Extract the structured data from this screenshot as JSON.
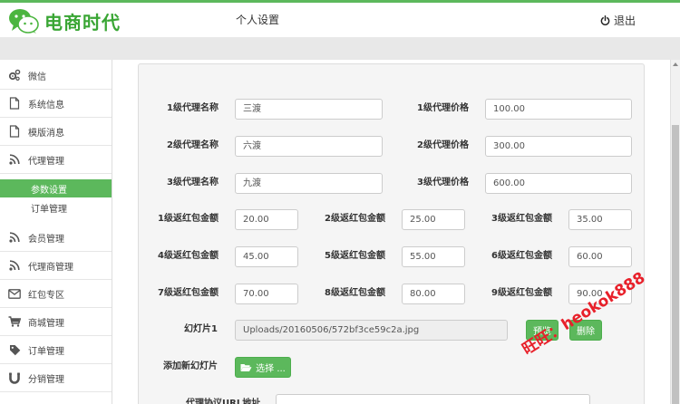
{
  "header": {
    "brand": "电商时代",
    "page_title": "个人设置",
    "logout_label": "退出",
    "accent_color": "#5cb85c"
  },
  "sidebar": {
    "items": [
      {
        "label": "微信",
        "icon": "gears-icon"
      },
      {
        "label": "系统信息",
        "icon": "file-icon"
      },
      {
        "label": "模版消息",
        "icon": "file-icon"
      },
      {
        "label": "代理管理",
        "icon": "rss-icon"
      },
      {
        "label": "会员管理",
        "icon": "rss-icon"
      },
      {
        "label": "代理商管理",
        "icon": "rss-icon"
      },
      {
        "label": "红包专区",
        "icon": "envelope-icon"
      },
      {
        "label": "商城管理",
        "icon": "cart-icon"
      },
      {
        "label": "订单管理",
        "icon": "tag-icon"
      },
      {
        "label": "分销管理",
        "icon": "magnet-icon"
      }
    ],
    "subitems": [
      {
        "label": "参数设置",
        "active": true
      },
      {
        "label": "订单管理",
        "active": false
      }
    ]
  },
  "form": {
    "agent_name_1_label": "1级代理名称",
    "agent_name_1": "三渡",
    "agent_price_1_label": "1级代理价格",
    "agent_price_1": "100.00",
    "agent_name_2_label": "2级代理名称",
    "agent_name_2": "六渡",
    "agent_price_2_label": "2级代理价格",
    "agent_price_2": "300.00",
    "agent_name_3_label": "3级代理名称",
    "agent_name_3": "九渡",
    "agent_price_3_label": "3级代理价格",
    "agent_price_3": "600.00",
    "redpack": [
      {
        "label": "1级返红包金额",
        "value": "20.00"
      },
      {
        "label": "2级返红包金额",
        "value": "25.00"
      },
      {
        "label": "3级返红包金额",
        "value": "35.00"
      },
      {
        "label": "4级返红包金额",
        "value": "45.00"
      },
      {
        "label": "5级返红包金额",
        "value": "55.00"
      },
      {
        "label": "6级返红包金额",
        "value": "60.00"
      },
      {
        "label": "7级返红包金额",
        "value": "70.00"
      },
      {
        "label": "8级返红包金额",
        "value": "80.00"
      },
      {
        "label": "9级返红包金额",
        "value": "90.00"
      }
    ],
    "slide1_label": "幻灯片1",
    "slide1_path": "Uploads/20160506/572bf3ce59c2a.jpg",
    "preview_label": "预览",
    "delete_label": "删除",
    "add_slide_label": "添加新幻灯片",
    "choose_label": "选择 ...",
    "agreement_url_label": "代理协议URL地址"
  },
  "watermark": "旺旺：heokok888"
}
